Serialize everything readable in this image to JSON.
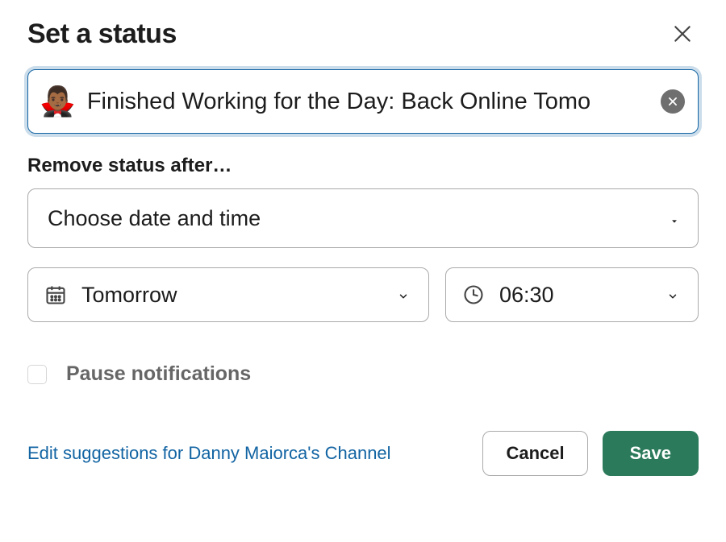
{
  "title": "Set a status",
  "status": {
    "emoji": "🧛🏾‍♂️",
    "text": "Finished Working for the Day: Back Online Tomo"
  },
  "removeAfter": {
    "label": "Remove status after…",
    "durationSelect": "Choose date and time",
    "dateValue": "Tomorrow",
    "timeValue": "06:30"
  },
  "pause": {
    "checked": false,
    "label": "Pause notifications"
  },
  "footer": {
    "editLink": "Edit suggestions for Danny Maiorca's Channel",
    "cancel": "Cancel",
    "save": "Save"
  }
}
